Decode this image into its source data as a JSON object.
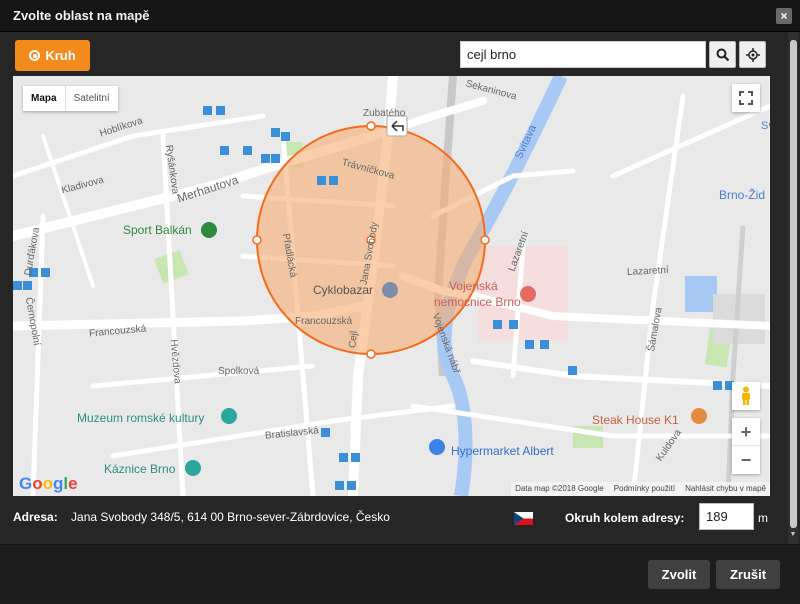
{
  "dialog": {
    "title": "Zvolte oblast na mapě",
    "close_symbol": "×"
  },
  "toolbar": {
    "circle_button_label": "Kruh",
    "search_value": "cejl brno"
  },
  "map": {
    "type_map": "Mapa",
    "type_satellite": "Satelitní",
    "zoom_in": "+",
    "zoom_out": "−",
    "google": "Google",
    "attribution": {
      "data": "Data map ©2018 Google",
      "terms": "Podmínky použití",
      "report": "Nahlásit chybu v mapě"
    },
    "streets": [
      "Hoblíkova",
      "Kladivova",
      "Ryšánkova",
      "Merhautova",
      "Zubatého",
      "Trávníčkova",
      "Sekaninova",
      "Svitava",
      "Durďákova",
      "Černopolní",
      "Francouzská",
      "Hvězdova",
      "Spolková",
      "Bratislavská",
      "Cejl",
      "Jana Svobody",
      "Přadlácká",
      "Francouzská",
      "Lazaretní",
      "Lazaretní",
      "Šámalova",
      "Kuldova",
      "Vojenská nábř",
      "Brno-Žid",
      "Svit"
    ],
    "pois": [
      "Sport Balkán",
      "Cyklobazar",
      "Vojenská",
      "nemocnice Brno",
      "Muzeum romské kultury",
      "Hypermarket Albert",
      "Steak House K1",
      "Káznice Brno"
    ]
  },
  "form": {
    "address_label": "Adresa:",
    "address_value": "Jana Svobody 348/5, 614 00 Brno-sever-Zábrdovice, Česko",
    "radius_label": "Okruh kolem adresy:",
    "radius_value": "189",
    "radius_unit": "m"
  },
  "buttons": {
    "confirm": "Zvolit",
    "cancel": "Zrušit"
  },
  "colors": {
    "accent": "#f28b1c",
    "circle_fill": "#f6ae72",
    "circle_stroke": "#f36b1d"
  }
}
